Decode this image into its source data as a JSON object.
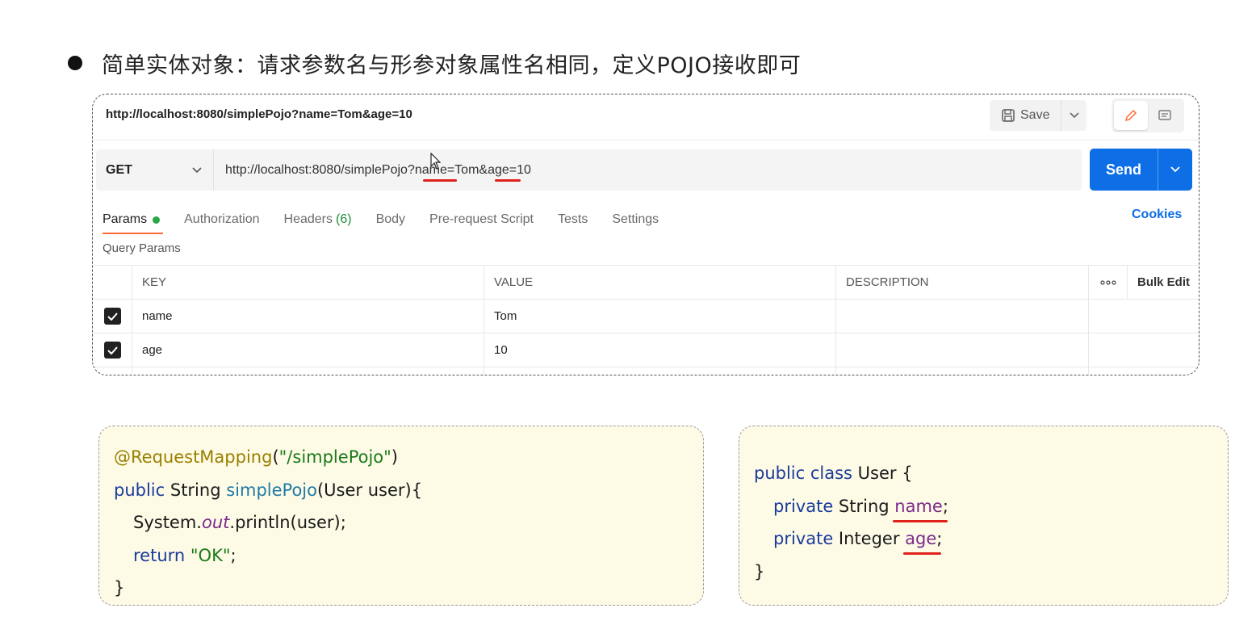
{
  "slide": {
    "bullet_text": "简单实体对象：请求参数名与形参对象属性名相同，定义POJO接收即可"
  },
  "postman": {
    "tab_url": "http://localhost:8080/simplePojo?name=Tom&age=10",
    "save_label": "Save",
    "method": "GET",
    "request_url": "http://localhost:8080/simplePojo?name=Tom&age=10",
    "send_label": "Send",
    "tabs": {
      "params": "Params",
      "authorization": "Authorization",
      "headers": "Headers",
      "headers_count": "(6)",
      "body": "Body",
      "pre_request": "Pre-request Script",
      "tests": "Tests",
      "settings": "Settings"
    },
    "cookies_label": "Cookies",
    "query_params_label": "Query Params",
    "table": {
      "col_key": "KEY",
      "col_value": "VALUE",
      "col_description": "DESCRIPTION",
      "more": "ooo",
      "bulk_edit": "Bulk Edit",
      "rows": [
        {
          "key": "name",
          "value": "Tom",
          "description": "",
          "checked": true
        },
        {
          "key": "age",
          "value": "10",
          "description": "",
          "checked": true
        }
      ]
    },
    "colors": {
      "send": "#0d6ee6",
      "active_tab": "#ff6c37",
      "underline": "#e0201b"
    }
  },
  "code_left": {
    "annotation": "@RequestMapping",
    "paren_open": "(",
    "path": "\"/simplePojo\"",
    "paren_close": ")",
    "kw_public": "public",
    "type_string": " String ",
    "method_name": "simplePojo",
    "signature_rest": "(User user){",
    "sysout_prefix": "System.",
    "sysout_out": "out",
    "sysout_rest": ".println(user);",
    "kw_return": "return",
    "return_value": " \"OK\"",
    "semicolon": ";",
    "close_brace": "}"
  },
  "code_right": {
    "kw_public_class": "public class",
    "class_name": " User {",
    "kw_private_1": "private",
    "type_1": " String ",
    "field_1": "name",
    "semi_1": ";",
    "kw_private_2": "private",
    "type_2": " Integer ",
    "field_2": "age",
    "semi_2": ";",
    "close_brace": "}"
  }
}
